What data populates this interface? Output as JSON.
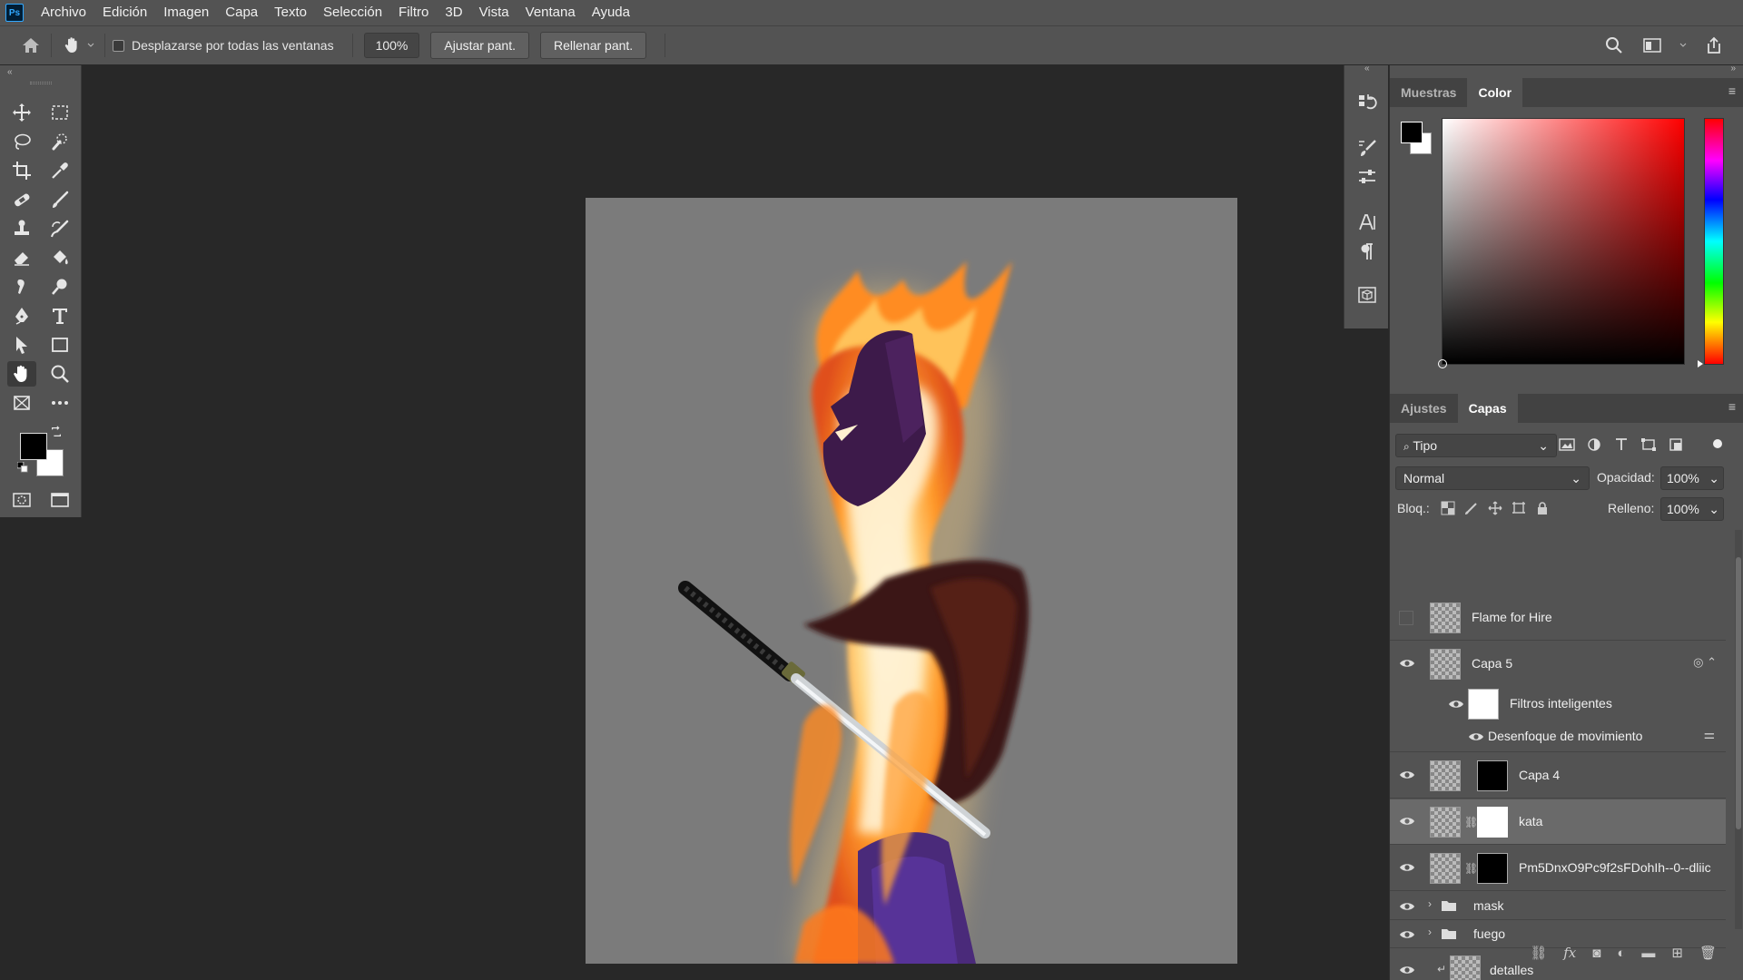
{
  "app": {
    "logo": "Ps"
  },
  "menu": [
    "Archivo",
    "Edición",
    "Imagen",
    "Capa",
    "Texto",
    "Selección",
    "Filtro",
    "3D",
    "Vista",
    "Ventana",
    "Ayuda"
  ],
  "options": {
    "scroll_all_label": "Desplazarse por todas las ventanas",
    "zoom_value": "100%",
    "fit_screen": "Ajustar pant.",
    "fill_screen": "Rellenar pant."
  },
  "color_panel": {
    "tabs": [
      "Muestras",
      "Color"
    ],
    "active_tab": "Color"
  },
  "layers_panel": {
    "tabs": [
      "Ajustes",
      "Capas"
    ],
    "active_tab": "Capas",
    "filter_label": "Tipo",
    "blend_mode": "Normal",
    "opacity_label": "Opacidad:",
    "opacity_value": "100%",
    "lock_label": "Bloq.:",
    "fill_label": "Relleno:",
    "fill_value": "100%",
    "layers": [
      {
        "name": "Flame for Hire",
        "visible": false
      },
      {
        "name": "Capa 5",
        "visible": true
      },
      {
        "name": "Filtros inteligentes",
        "visible": true
      },
      {
        "name": "Desenfoque de movimiento",
        "visible": true
      },
      {
        "name": "Capa 4",
        "visible": true
      },
      {
        "name": "kata",
        "visible": true,
        "selected": true
      },
      {
        "name": "Pm5DnxO9Pc9f2sFDohIh--0--dliic",
        "visible": true
      },
      {
        "name": "mask",
        "visible": true,
        "type": "group"
      },
      {
        "name": "fuego",
        "visible": true,
        "type": "group"
      },
      {
        "name": "detalles",
        "visible": true
      }
    ]
  },
  "colors": {
    "foreground": "#000000",
    "background": "#ffffff",
    "canvas_bg": "#7b7b7b"
  }
}
